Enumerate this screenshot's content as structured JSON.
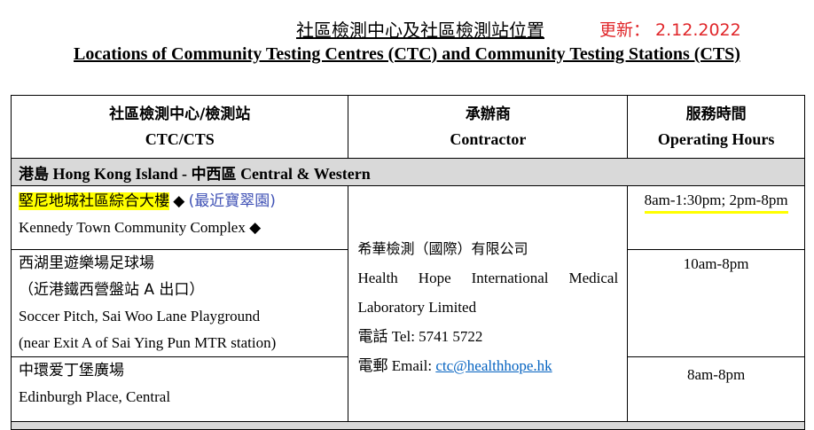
{
  "header": {
    "title_zh": "社區檢測中心及社區檢測站位置",
    "update": "更新： 2.12.2022",
    "title_en": "Locations of Community Testing Centres (CTC) and Community Testing Stations (CTS)"
  },
  "table": {
    "col1_zh": "社區檢測中心/檢測站",
    "col1_en": "CTC/CTS",
    "col2_zh": "承辦商",
    "col2_en": "Contractor",
    "col3_zh": "服務時間",
    "col3_en": "Operating Hours",
    "region_zh1": "港島",
    "region_en1": "Hong Kong Island -",
    "region_zh2": "中西區",
    "region_en2": "Central & Western",
    "rows": [
      {
        "name_zh": "堅尼地城社區綜合大樓",
        "marker": "◆",
        "note_zh": "(最近寶翠園)",
        "name_en": "Kennedy Town Community Complex ◆",
        "hours": "8am-1:30pm; 2pm-8pm"
      },
      {
        "name_zh": "西湖里遊樂場足球場",
        "note_zh": "（近港鐵西營盤站 A 出口）",
        "name_en": "Soccer Pitch, Sai Woo Lane Playground",
        "note_en": "(near Exit A of Sai Ying Pun MTR station)",
        "hours": "10am-8pm"
      },
      {
        "name_zh": "中環爱丁堡廣場",
        "name_en": "Edinburgh Place, Central",
        "hours": "8am-8pm"
      }
    ],
    "contractor": {
      "name_zh": "希華檢測（國際）有限公司",
      "name_en_line1": "Health Hope International Medical",
      "name_en_line2": "Laboratory Limited",
      "tel": "電話 Tel: 5741 5722",
      "email_label": "電郵 Email: ",
      "email": "ctc@healthhope.hk"
    }
  }
}
